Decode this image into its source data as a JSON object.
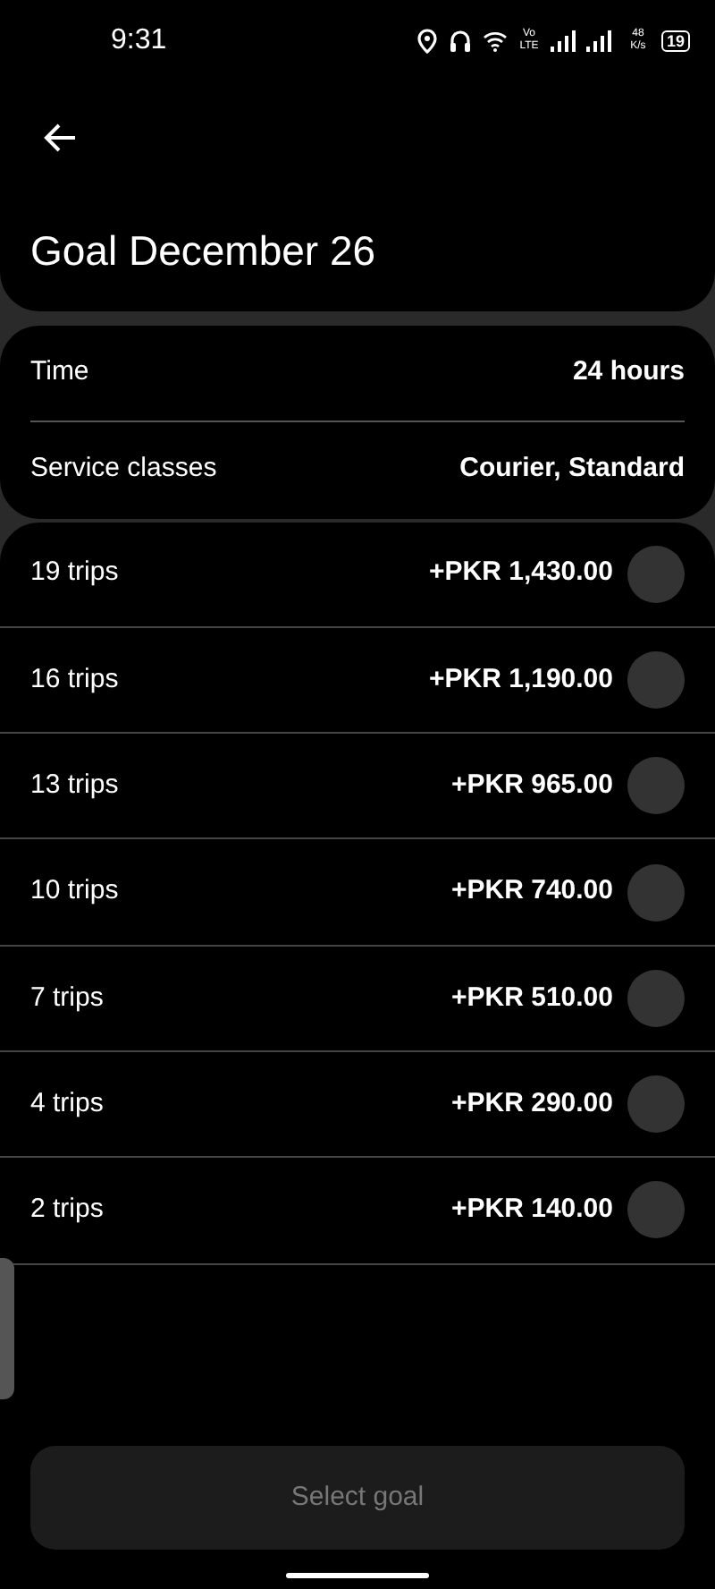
{
  "status_bar": {
    "time": "9:31",
    "network": "Vo LTE",
    "speed": "48 K/s",
    "battery": "19"
  },
  "header": {
    "title": "Goal December 26"
  },
  "details": [
    {
      "label": "Time",
      "value": "24 hours"
    },
    {
      "label": "Service classes",
      "value": "Courier, Standard"
    }
  ],
  "goals": [
    {
      "trips": "19 trips",
      "reward": "+PKR 1,430.00",
      "selected": false
    },
    {
      "trips": "16 trips",
      "reward": "+PKR 1,190.00",
      "selected": false
    },
    {
      "trips": "13 trips",
      "reward": "+PKR 965.00",
      "selected": false
    },
    {
      "trips": "10 trips",
      "reward": "+PKR 740.00",
      "selected": false
    },
    {
      "trips": "7 trips",
      "reward": "+PKR 510.00",
      "selected": false
    },
    {
      "trips": "4 trips",
      "reward": "+PKR 290.00",
      "selected": false
    },
    {
      "trips": "2 trips",
      "reward": "+PKR 140.00",
      "selected": false
    }
  ],
  "action": {
    "label": "Select goal",
    "disabled": true
  }
}
